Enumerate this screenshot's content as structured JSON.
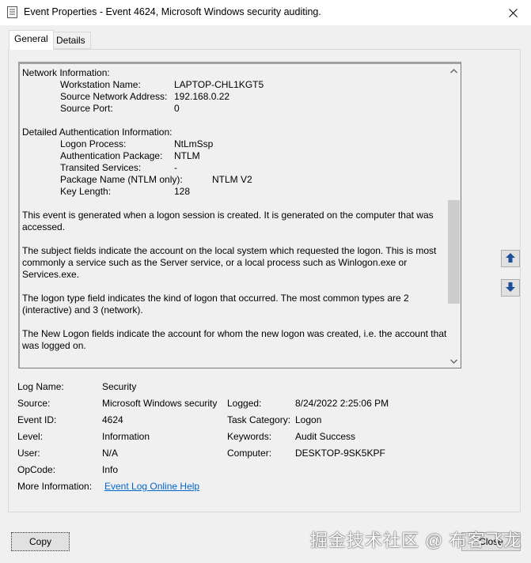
{
  "window": {
    "title": "Event Properties - Event 4624, Microsoft Windows security auditing."
  },
  "tabs": [
    {
      "label": "General"
    },
    {
      "label": "Details"
    }
  ],
  "description": {
    "network_header": "Network Information:",
    "network": [
      {
        "label": "Workstation Name:",
        "value": "LAPTOP-CHL1KGT5"
      },
      {
        "label": "Source Network Address:",
        "value": "192.168.0.22"
      },
      {
        "label": "Source Port:",
        "value": "0"
      }
    ],
    "auth_header": "Detailed Authentication Information:",
    "auth": [
      {
        "label": "Logon Process:",
        "value": "NtLmSsp"
      },
      {
        "label": "Authentication Package:",
        "value": "NTLM"
      },
      {
        "label": "Transited Services:",
        "value": "-"
      },
      {
        "label": "Package Name (NTLM only):",
        "value": "NTLM V2"
      },
      {
        "label": "Key Length:",
        "value": "128"
      }
    ],
    "paragraphs": [
      "This event is generated when a logon session is created. It is generated on the computer that was accessed.",
      "The subject fields indicate the account on the local system which requested the logon. This is most commonly a service such as the Server service, or a local process such as Winlogon.exe or Services.exe.",
      "The logon type field indicates the kind of logon that occurred. The most common types are 2 (interactive) and 3 (network).",
      "The New Logon fields indicate the account for whom the new logon was created, i.e. the account that was logged on."
    ]
  },
  "fields": {
    "log_name": {
      "label": "Log Name:",
      "value": "Security"
    },
    "source": {
      "label": "Source:",
      "value": "Microsoft Windows security"
    },
    "logged": {
      "label": "Logged:",
      "value": "8/24/2022 2:25:06 PM"
    },
    "event_id": {
      "label": "Event ID:",
      "value": "4624"
    },
    "task_category": {
      "label": "Task Category:",
      "value": "Logon"
    },
    "level": {
      "label": "Level:",
      "value": "Information"
    },
    "keywords": {
      "label": "Keywords:",
      "value": "Audit Success"
    },
    "user": {
      "label": "User:",
      "value": "N/A"
    },
    "computer": {
      "label": "Computer:",
      "value": "DESKTOP-9SK5KPF"
    },
    "opcode": {
      "label": "OpCode:",
      "value": "Info"
    },
    "more_info": {
      "label": "More Information:",
      "value": "Event Log Online Help"
    }
  },
  "buttons": {
    "copy": "Copy",
    "close": "Close"
  },
  "watermark": "掘金技术社区 @ 布客飞龙",
  "icons": {
    "app": "event-properties-icon",
    "close": "close-icon",
    "up": "arrow-up-icon",
    "down": "arrow-down-icon"
  },
  "colors": {
    "link": "#0066cc",
    "nav_arrow": "#1f4e9c"
  }
}
